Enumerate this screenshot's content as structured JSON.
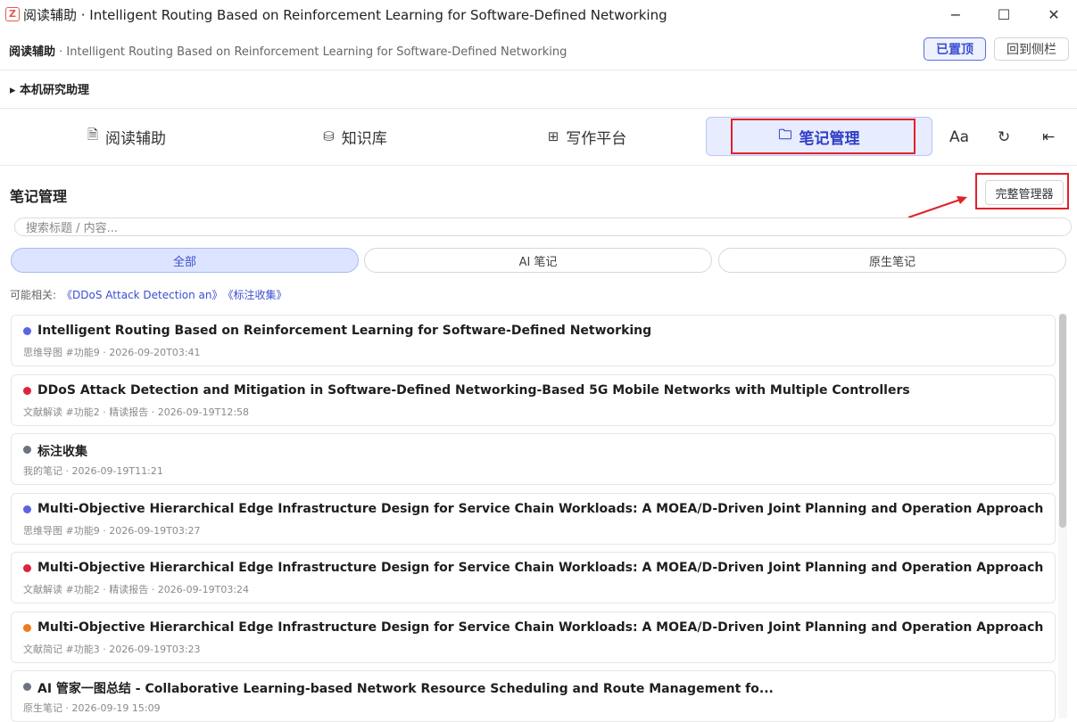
{
  "window": {
    "title": "阅读辅助 · Intelligent Routing Based on Reinforcement Learning for Software-Defined Networking",
    "logo_letter": "Z",
    "minimize_glyph": "−",
    "maximize_glyph": "☐",
    "close_glyph": "✕"
  },
  "header": {
    "app_name": "阅读辅助",
    "paper_title": " · Intelligent Routing Based on Reinforcement Learning for Software-Defined Networking",
    "pinned_label": "已置顶",
    "back_sidebar_label": "回到侧栏"
  },
  "assistant": {
    "label": "▸ 本机研究助理"
  },
  "tabs": [
    {
      "label": "阅读辅助",
      "icon": "document-icon",
      "glyph": "🗎"
    },
    {
      "label": "知识库",
      "icon": "database-icon",
      "glyph": "⛁"
    },
    {
      "label": "写作平台",
      "icon": "grid-icon",
      "glyph": "⊞"
    },
    {
      "label": "笔记管理",
      "icon": "folder-icon",
      "glyph": "🗀",
      "active": true
    }
  ],
  "tools": {
    "font_label": "Aa",
    "refresh_glyph": "↻",
    "collapse_glyph": "⇤"
  },
  "notes": {
    "section_title": "笔记管理",
    "full_manager_label": "完整管理器",
    "search_placeholder": "搜索标题 / 内容...",
    "filters": [
      "全部",
      "AI 笔记",
      "原生笔记"
    ],
    "active_filter": "全部",
    "related_label": "可能相关:",
    "related_links": [
      "《DDoS Attack Detection an》",
      "《标注收集》"
    ],
    "items": [
      {
        "title": "Intelligent Routing Based on Reinforcement Learning for Software-Defined Networking",
        "meta": "思维导图 #功能9 · 2026-09-20T03:41",
        "color": "#5b63e6"
      },
      {
        "title": "DDoS Attack Detection and Mitigation in Software-Defined Networking-Based 5G Mobile Networks with Multiple Controllers",
        "meta": "文献解读 #功能2 · 精读报告 · 2026-09-19T12:58",
        "color": "#e0223f"
      },
      {
        "title": "标注收集",
        "meta": "我的笔记 · 2026-09-19T11:21",
        "color": "#6b7280"
      },
      {
        "title": "Multi-Objective Hierarchical Edge Infrastructure Design for Service Chain Workloads: A MOEA/D-Driven Joint Planning and Operation Approach",
        "meta": "思维导图 #功能9 · 2026-09-19T03:27",
        "color": "#5b63e6"
      },
      {
        "title": "Multi-Objective Hierarchical Edge Infrastructure Design for Service Chain Workloads: A MOEA/D-Driven Joint Planning and Operation Approach",
        "meta": "文献解读 #功能2 · 精读报告 · 2026-09-19T03:24",
        "color": "#e0223f"
      },
      {
        "title": "Multi-Objective Hierarchical Edge Infrastructure Design for Service Chain Workloads: A MOEA/D-Driven Joint Planning and Operation Approach",
        "meta": "文献简记 #功能3 · 2026-09-19T03:23",
        "color": "#f27a1a"
      },
      {
        "title": "AI 管家一图总结 - Collaborative Learning-based Network Resource Scheduling and Route Management fo...",
        "meta": "原生笔记 · 2026-09-19 15:09",
        "color": "#6b7280"
      }
    ]
  },
  "accent_color": "#3b4fd0",
  "annotation_color": "#e0222a"
}
